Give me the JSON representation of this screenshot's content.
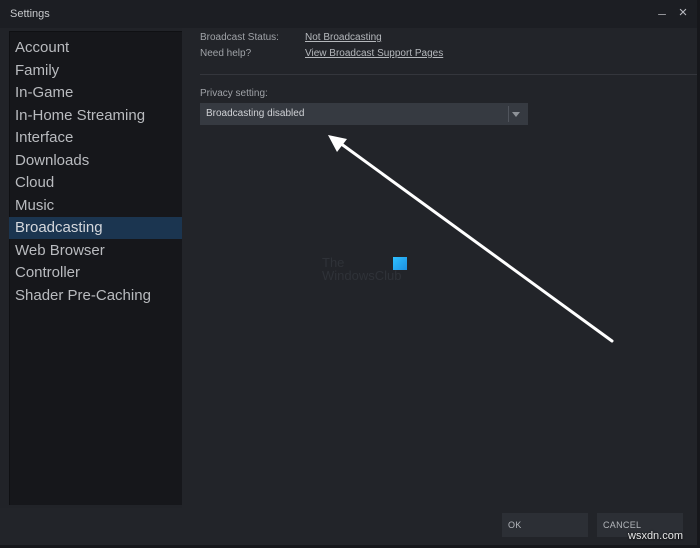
{
  "window": {
    "title": "Settings",
    "minimize_glyph": "–",
    "close_glyph": "×"
  },
  "sidebar": {
    "items": [
      {
        "label": "Account"
      },
      {
        "label": "Family"
      },
      {
        "label": "In-Game"
      },
      {
        "label": "In-Home Streaming"
      },
      {
        "label": "Interface"
      },
      {
        "label": "Downloads"
      },
      {
        "label": "Cloud"
      },
      {
        "label": "Music"
      },
      {
        "label": "Broadcasting",
        "active": true
      },
      {
        "label": "Web Browser"
      },
      {
        "label": "Controller"
      },
      {
        "label": "Shader Pre-Caching"
      }
    ]
  },
  "broadcasting": {
    "status_label": "Broadcast Status:",
    "status_value": "Not Broadcasting",
    "help_label": "Need help?",
    "help_link": "View Broadcast Support Pages",
    "privacy_label": "Privacy setting:",
    "privacy_value": "Broadcasting disabled"
  },
  "footer": {
    "ok_label": "OK",
    "cancel_label": "CANCEL"
  },
  "watermarks": {
    "line1": "The",
    "line2": "WindowsClub",
    "site": "wsxdn.com"
  },
  "colors": {
    "active_item": "#1b3550",
    "annotation_arrow": "#ffffff"
  }
}
